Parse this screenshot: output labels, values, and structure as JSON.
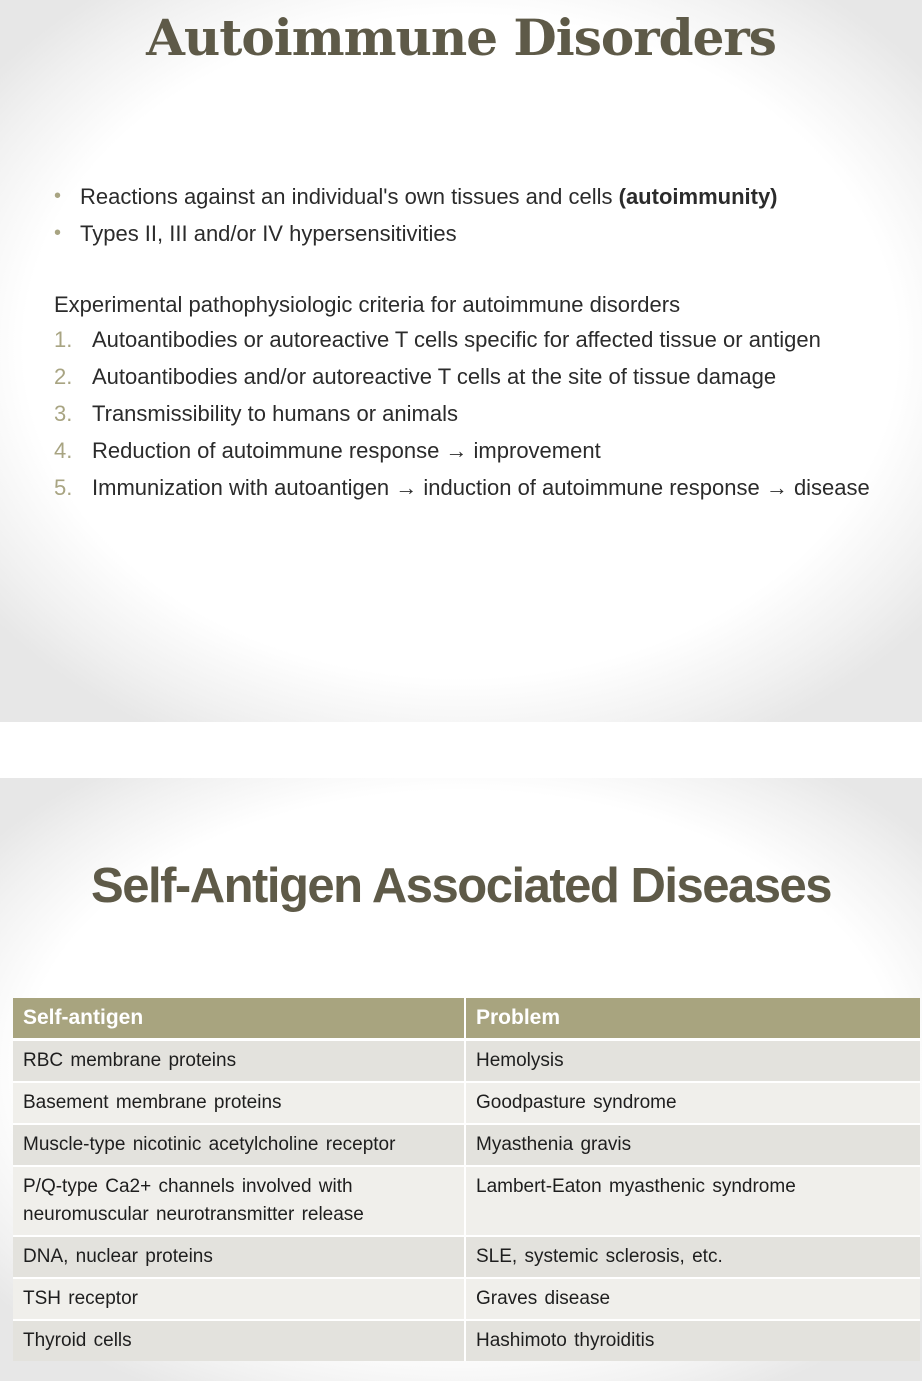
{
  "slide1": {
    "title": "Autoimmune Disorders",
    "bullets": [
      {
        "text": "Reactions against an individual's own tissues and cells ",
        "bold": "(autoimmunity)"
      },
      {
        "text": "Types II, III and/or IV hypersensitivities",
        "bold": ""
      }
    ],
    "criteria_heading": "Experimental pathophysiologic criteria for autoimmune disorders",
    "criteria": [
      {
        "num": "1.",
        "text": "Autoantibodies or autoreactive T cells specific for affected tissue or antigen"
      },
      {
        "num": "2.",
        "text": "Autoantibodies and/or autoreactive T cells at the site of tissue damage"
      },
      {
        "num": "3.",
        "text": "Transmissibility to humans or animals"
      },
      {
        "num": "4.",
        "text": "Reduction of autoimmune response → improvement"
      },
      {
        "num": "5.",
        "text": "Immunization with autoantigen → induction of autoimmune response → disease"
      }
    ]
  },
  "slide2": {
    "title": "Self-Antigen Associated Diseases",
    "table": {
      "headers": [
        "Self-antigen",
        "Problem"
      ],
      "rows": [
        [
          "RBC membrane proteins",
          "Hemolysis"
        ],
        [
          "Basement membrane proteins",
          "Goodpasture syndrome"
        ],
        [
          "Muscle-type nicotinic acetylcholine receptor",
          "Myasthenia gravis"
        ],
        [
          "P/Q-type Ca2+ channels involved with neuromuscular neurotransmitter release",
          "Lambert-Eaton myasthenic syndrome"
        ],
        [
          "DNA, nuclear proteins",
          "SLE, systemic sclerosis, etc."
        ],
        [
          "TSH receptor",
          "Graves disease"
        ],
        [
          "Thyroid cells",
          "Hashimoto thyroiditis"
        ]
      ]
    }
  },
  "colors": {
    "title": "#5e5a48",
    "accent": "#a8a482",
    "table_header": "#a8a47f",
    "row_odd": "#e3e2dd",
    "row_even": "#f0efeb"
  }
}
